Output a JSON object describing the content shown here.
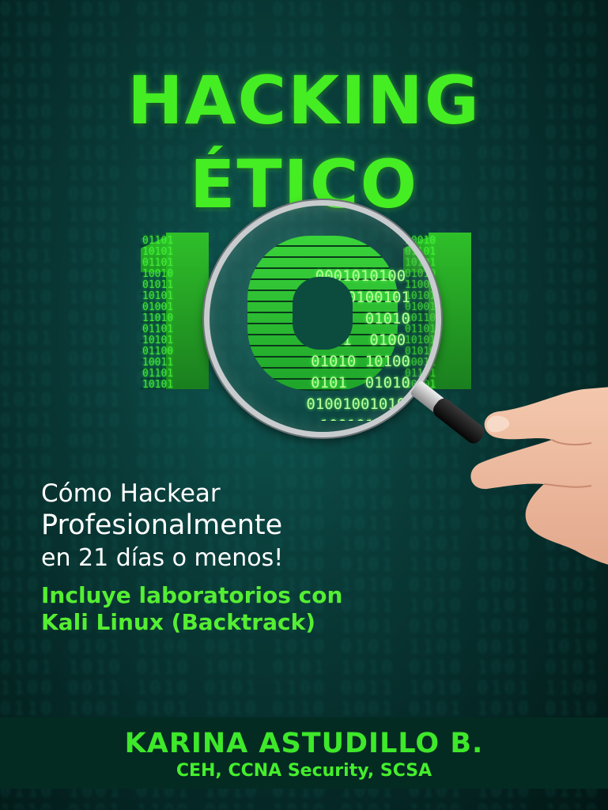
{
  "cover": {
    "title_line1": "HACKING",
    "title_line2": "ÉTICO",
    "number": "101",
    "subtitle_line1": "Cómo Hackear",
    "subtitle_line2": "Profesionalmente",
    "subtitle_line3": "en 21 días o menos!",
    "note_line1": "Incluye laboratorios con",
    "note_line2": "Kali Linux (Backtrack)",
    "author_name": "KARINA ASTUDILLO B.",
    "author_credentials": "CEH, CCNA Security, SCSA"
  },
  "colors": {
    "accent_green": "#44ee22",
    "background_teal": "#0a3d3a",
    "author_band": "#032b22"
  },
  "icons": [
    "magnifying-glass-icon",
    "hand-illustration"
  ]
}
